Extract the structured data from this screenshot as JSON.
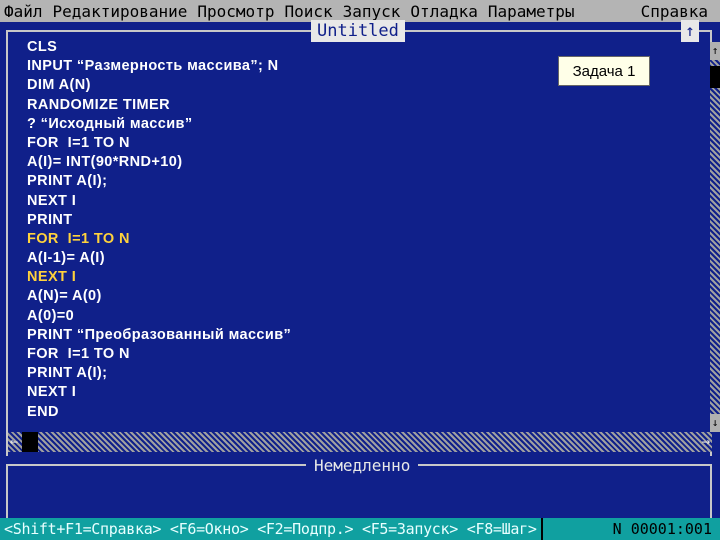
{
  "menu": {
    "items": [
      "Файл",
      "Редактирование",
      "Просмотр",
      "Поиск",
      "Запуск",
      "Отладка",
      "Параметры"
    ],
    "help": "Справка"
  },
  "editor": {
    "title": "Untitled",
    "maximize_icon": "↑",
    "lines": [
      {
        "text": "CLS",
        "highlight": false
      },
      {
        "text": "INPUT “Размерность массива”; N",
        "highlight": false
      },
      {
        "text": "DIM A(N)",
        "highlight": false
      },
      {
        "text": "RANDOMIZE TIMER",
        "highlight": false
      },
      {
        "text": "? “Исходный массив”",
        "highlight": false
      },
      {
        "text": "FOR  I=1 TO N",
        "highlight": false
      },
      {
        "text": "A(I)= INT(90*RND+10)",
        "highlight": false
      },
      {
        "text": "PRINT A(I);",
        "highlight": false
      },
      {
        "text": "NEXT I",
        "highlight": false
      },
      {
        "text": "PRINT",
        "highlight": false
      },
      {
        "text": "FOR  I=1 TO N",
        "highlight": true
      },
      {
        "text": "A(I-1)= A(I)",
        "highlight": false
      },
      {
        "text": "NEXT I",
        "highlight": true
      },
      {
        "text": "A(N)= A(0)",
        "highlight": false
      },
      {
        "text": "A(0)=0",
        "highlight": false
      },
      {
        "text": "PRINT “Преобразованный массив”",
        "highlight": false
      },
      {
        "text": "FOR  I=1 TO N",
        "highlight": false
      },
      {
        "text": "PRINT A(I);",
        "highlight": false
      },
      {
        "text": "NEXT I",
        "highlight": false
      },
      {
        "text": "END",
        "highlight": false
      }
    ],
    "task_label": "Задача 1"
  },
  "scroll": {
    "up": "↑",
    "down": "↓",
    "left": "←",
    "right": "→"
  },
  "immediate": {
    "title": "Немедленно"
  },
  "status": {
    "hints": "<Shift+F1=Справка> <F6=Окно> <F2=Подпр.> <F5=Запуск> <F8=Шаг>",
    "position": "N 00001:001"
  },
  "colors": {
    "background": "#10208a",
    "highlight": "#ffd23c",
    "menu": "#b4b4b4",
    "status": "#10a0a0"
  }
}
